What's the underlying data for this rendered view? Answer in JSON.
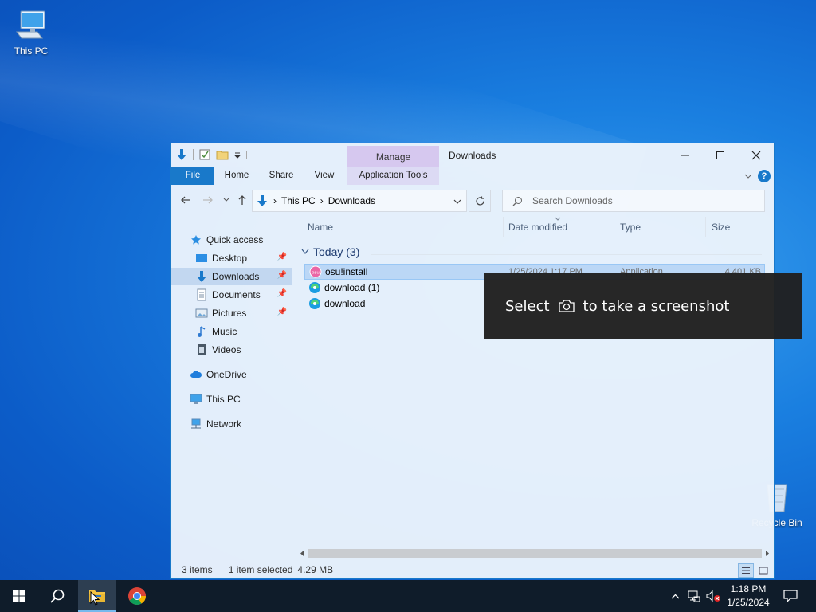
{
  "desktop": {
    "icons": [
      {
        "label": "This PC",
        "icon": "this-pc-icon"
      },
      {
        "label": "Recycle Bin",
        "icon": "recycle-bin-icon"
      }
    ]
  },
  "explorer": {
    "title": "Downloads",
    "context_tab": "Manage",
    "ribbon_tabs": [
      "File",
      "Home",
      "Share",
      "View",
      "Application Tools"
    ],
    "breadcrumb": [
      "This PC",
      "Downloads"
    ],
    "search_placeholder": "Search Downloads",
    "nav": {
      "quick_access": "Quick access",
      "items": [
        "Desktop",
        "Downloads",
        "Documents",
        "Pictures",
        "Music",
        "Videos"
      ],
      "onedrive": "OneDrive",
      "this_pc": "This PC",
      "network": "Network"
    },
    "columns": [
      "Name",
      "Date modified",
      "Type",
      "Size"
    ],
    "group": "Today (3)",
    "files": [
      {
        "name": "osu!install",
        "date": "1/25/2024 1:17 PM",
        "type": "Application",
        "size": "4,401 KB",
        "selected": true
      },
      {
        "name": "download (1)",
        "date": "",
        "type": "",
        "size": "",
        "selected": false
      },
      {
        "name": "download",
        "date": "",
        "type": "",
        "size": "",
        "selected": false
      }
    ],
    "status": {
      "count": "3 items",
      "selection": "1 item selected",
      "size": "4.29 MB"
    }
  },
  "tooltip": {
    "before": "Select",
    "after": "to take a screenshot"
  },
  "taskbar": {
    "time": "1:18 PM",
    "date": "1/25/2024"
  },
  "colors": {
    "accent": "#1979ca",
    "manage_tab": "#d6c8ef",
    "taskbar": "#0f1c2a"
  }
}
